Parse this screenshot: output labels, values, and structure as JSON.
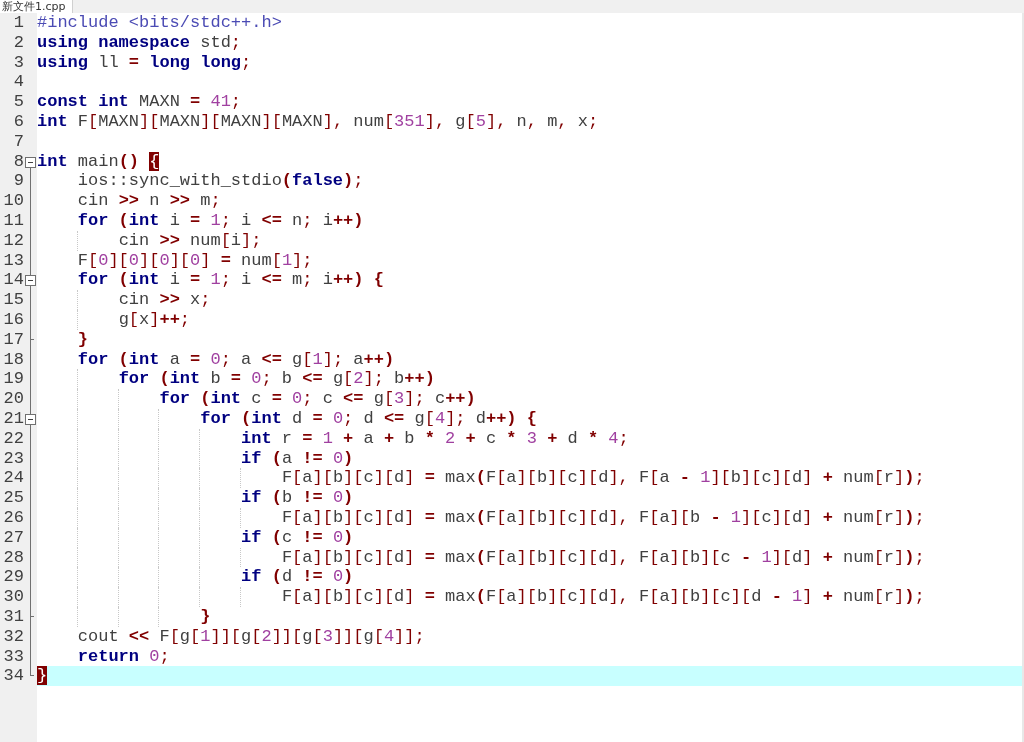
{
  "tab": {
    "title": "新文件1.cpp"
  },
  "lines": [
    {
      "number": "1",
      "kind": "plain",
      "current": false,
      "tokens": [
        {
          "kind": "pp",
          "text": "#include <bits/stdc++.h>"
        }
      ]
    },
    {
      "number": "2",
      "kind": "plain",
      "current": false,
      "tokens": [
        {
          "kind": "kw",
          "text": "using"
        },
        {
          "kind": "kw",
          "text": " namespace"
        },
        {
          "kind": "id",
          "text": " std"
        },
        {
          "kind": "sym",
          "text": ";"
        }
      ]
    },
    {
      "number": "3",
      "kind": "plain",
      "current": false,
      "tokens": [
        {
          "kind": "kw",
          "text": "using"
        },
        {
          "kind": "id",
          "text": " ll "
        },
        {
          "kind": "op",
          "text": "="
        },
        {
          "kind": "kw",
          "text": " long"
        },
        {
          "kind": "kw",
          "text": " long"
        },
        {
          "kind": "sym",
          "text": ";"
        }
      ]
    },
    {
      "number": "4",
      "kind": "plain",
      "current": false
    },
    {
      "number": "5",
      "kind": "plain",
      "current": false,
      "tokens": [
        {
          "kind": "kw",
          "text": "const"
        },
        {
          "kind": "kw",
          "text": " int"
        },
        {
          "kind": "id",
          "text": " MAXN "
        },
        {
          "kind": "op",
          "text": "="
        },
        {
          "kind": "num",
          "text": " 41"
        },
        {
          "kind": "sym",
          "text": ";"
        }
      ]
    },
    {
      "number": "6",
      "kind": "plain",
      "current": false,
      "tokens": [
        {
          "kind": "kw",
          "text": "int"
        },
        {
          "kind": "id",
          "text": " F"
        },
        {
          "kind": "sym",
          "text": "["
        },
        {
          "kind": "id",
          "text": "MAXN"
        },
        {
          "kind": "sym",
          "text": "]["
        },
        {
          "kind": "id",
          "text": "MAXN"
        },
        {
          "kind": "sym",
          "text": "]["
        },
        {
          "kind": "id",
          "text": "MAXN"
        },
        {
          "kind": "sym",
          "text": "]["
        },
        {
          "kind": "id",
          "text": "MAXN"
        },
        {
          "kind": "sym",
          "text": "],"
        },
        {
          "kind": "id",
          "text": " num"
        },
        {
          "kind": "sym",
          "text": "["
        },
        {
          "kind": "num",
          "text": "351"
        },
        {
          "kind": "sym",
          "text": "],"
        },
        {
          "kind": "id",
          "text": " g"
        },
        {
          "kind": "sym",
          "text": "["
        },
        {
          "kind": "num",
          "text": "5"
        },
        {
          "kind": "sym",
          "text": "],"
        },
        {
          "kind": "id",
          "text": " n"
        },
        {
          "kind": "sym",
          "text": ","
        },
        {
          "kind": "id",
          "text": " m"
        },
        {
          "kind": "sym",
          "text": ","
        },
        {
          "kind": "id",
          "text": " x"
        },
        {
          "kind": "sym",
          "text": ";"
        }
      ]
    },
    {
      "number": "7",
      "kind": "plain",
      "current": false
    },
    {
      "number": "8",
      "kind": "start",
      "current": false,
      "tokens": [
        {
          "kind": "kw",
          "text": "int"
        },
        {
          "kind": "id",
          "text": " main"
        },
        {
          "kind": "op",
          "text": "() "
        },
        {
          "kind": "match",
          "text": "{"
        }
      ]
    },
    {
      "number": "9",
      "kind": "plain",
      "current": false,
      "tokens": [
        {
          "kind": "id",
          "text": "    ios::sync_with_stdio"
        },
        {
          "kind": "op",
          "text": "("
        },
        {
          "kind": "kw",
          "text": "false"
        },
        {
          "kind": "op",
          "text": ")"
        },
        {
          "kind": "sym",
          "text": ";"
        }
      ]
    },
    {
      "number": "10",
      "kind": "plain",
      "current": false,
      "tokens": [
        {
          "kind": "id",
          "text": "    cin "
        },
        {
          "kind": "op",
          "text": ">>"
        },
        {
          "kind": "id",
          "text": " n "
        },
        {
          "kind": "op",
          "text": ">>"
        },
        {
          "kind": "id",
          "text": " m"
        },
        {
          "kind": "sym",
          "text": ";"
        }
      ]
    },
    {
      "number": "11",
      "kind": "plain",
      "current": false,
      "tokens": [
        {
          "kind": "kw",
          "text": "    for"
        },
        {
          "kind": "op",
          "text": " ("
        },
        {
          "kind": "kw",
          "text": "int"
        },
        {
          "kind": "id",
          "text": " i "
        },
        {
          "kind": "op",
          "text": "="
        },
        {
          "kind": "num",
          "text": " 1"
        },
        {
          "kind": "sym",
          "text": ";"
        },
        {
          "kind": "id",
          "text": " i "
        },
        {
          "kind": "op",
          "text": "<="
        },
        {
          "kind": "id",
          "text": " n"
        },
        {
          "kind": "sym",
          "text": ";"
        },
        {
          "kind": "id",
          "text": " i"
        },
        {
          "kind": "op",
          "text": "++)"
        }
      ]
    },
    {
      "number": "12",
      "kind": "plain",
      "current": false,
      "tokens": [
        {
          "kind": "id",
          "text": "        cin "
        },
        {
          "kind": "op",
          "text": ">>"
        },
        {
          "kind": "id",
          "text": " num"
        },
        {
          "kind": "sym",
          "text": "["
        },
        {
          "kind": "id",
          "text": "i"
        },
        {
          "kind": "sym",
          "text": "];"
        }
      ]
    },
    {
      "number": "13",
      "kind": "plain",
      "current": false,
      "tokens": [
        {
          "kind": "id",
          "text": "    F"
        },
        {
          "kind": "sym",
          "text": "["
        },
        {
          "kind": "num",
          "text": "0"
        },
        {
          "kind": "sym",
          "text": "]["
        },
        {
          "kind": "num",
          "text": "0"
        },
        {
          "kind": "sym",
          "text": "]["
        },
        {
          "kind": "num",
          "text": "0"
        },
        {
          "kind": "sym",
          "text": "]["
        },
        {
          "kind": "num",
          "text": "0"
        },
        {
          "kind": "sym",
          "text": "]"
        },
        {
          "kind": "op",
          "text": " ="
        },
        {
          "kind": "id",
          "text": " num"
        },
        {
          "kind": "sym",
          "text": "["
        },
        {
          "kind": "num",
          "text": "1"
        },
        {
          "kind": "sym",
          "text": "];"
        }
      ]
    },
    {
      "number": "14",
      "kind": "start",
      "current": false,
      "tokens": [
        {
          "kind": "kw",
          "text": "    for"
        },
        {
          "kind": "op",
          "text": " ("
        },
        {
          "kind": "kw",
          "text": "int"
        },
        {
          "kind": "id",
          "text": " i "
        },
        {
          "kind": "op",
          "text": "="
        },
        {
          "kind": "num",
          "text": " 1"
        },
        {
          "kind": "sym",
          "text": ";"
        },
        {
          "kind": "id",
          "text": " i "
        },
        {
          "kind": "op",
          "text": "<="
        },
        {
          "kind": "id",
          "text": " m"
        },
        {
          "kind": "sym",
          "text": ";"
        },
        {
          "kind": "id",
          "text": " i"
        },
        {
          "kind": "op",
          "text": "++)"
        },
        {
          "kind": "op",
          "text": " {"
        }
      ]
    },
    {
      "number": "15",
      "kind": "plain",
      "current": false,
      "tokens": [
        {
          "kind": "id",
          "text": "        cin "
        },
        {
          "kind": "op",
          "text": ">>"
        },
        {
          "kind": "id",
          "text": " x"
        },
        {
          "kind": "sym",
          "text": ";"
        }
      ]
    },
    {
      "number": "16",
      "kind": "plain",
      "current": false,
      "tokens": [
        {
          "kind": "id",
          "text": "        g"
        },
        {
          "kind": "sym",
          "text": "["
        },
        {
          "kind": "id",
          "text": "x"
        },
        {
          "kind": "sym",
          "text": "]"
        },
        {
          "kind": "op",
          "text": "++"
        },
        {
          "kind": "sym",
          "text": ";"
        }
      ]
    },
    {
      "number": "17",
      "kind": "end",
      "current": false,
      "tokens": [
        {
          "kind": "op",
          "text": "    }"
        }
      ]
    },
    {
      "number": "18",
      "kind": "plain",
      "current": false,
      "tokens": [
        {
          "kind": "kw",
          "text": "    for"
        },
        {
          "kind": "op",
          "text": " ("
        },
        {
          "kind": "kw",
          "text": "int"
        },
        {
          "kind": "id",
          "text": " a "
        },
        {
          "kind": "op",
          "text": "="
        },
        {
          "kind": "num",
          "text": " 0"
        },
        {
          "kind": "sym",
          "text": ";"
        },
        {
          "kind": "id",
          "text": " a "
        },
        {
          "kind": "op",
          "text": "<="
        },
        {
          "kind": "id",
          "text": " g"
        },
        {
          "kind": "sym",
          "text": "["
        },
        {
          "kind": "num",
          "text": "1"
        },
        {
          "kind": "sym",
          "text": "];"
        },
        {
          "kind": "id",
          "text": " a"
        },
        {
          "kind": "op",
          "text": "++)"
        }
      ]
    },
    {
      "number": "19",
      "kind": "plain",
      "current": false,
      "tokens": [
        {
          "kind": "kw",
          "text": "        for"
        },
        {
          "kind": "op",
          "text": " ("
        },
        {
          "kind": "kw",
          "text": "int"
        },
        {
          "kind": "id",
          "text": " b "
        },
        {
          "kind": "op",
          "text": "="
        },
        {
          "kind": "num",
          "text": " 0"
        },
        {
          "kind": "sym",
          "text": ";"
        },
        {
          "kind": "id",
          "text": " b "
        },
        {
          "kind": "op",
          "text": "<="
        },
        {
          "kind": "id",
          "text": " g"
        },
        {
          "kind": "sym",
          "text": "["
        },
        {
          "kind": "num",
          "text": "2"
        },
        {
          "kind": "sym",
          "text": "];"
        },
        {
          "kind": "id",
          "text": " b"
        },
        {
          "kind": "op",
          "text": "++)"
        }
      ]
    },
    {
      "number": "20",
      "kind": "plain",
      "current": false,
      "tokens": [
        {
          "kind": "kw",
          "text": "            for"
        },
        {
          "kind": "op",
          "text": " ("
        },
        {
          "kind": "kw",
          "text": "int"
        },
        {
          "kind": "id",
          "text": " c "
        },
        {
          "kind": "op",
          "text": "="
        },
        {
          "kind": "num",
          "text": " 0"
        },
        {
          "kind": "sym",
          "text": ";"
        },
        {
          "kind": "id",
          "text": " c "
        },
        {
          "kind": "op",
          "text": "<="
        },
        {
          "kind": "id",
          "text": " g"
        },
        {
          "kind": "sym",
          "text": "["
        },
        {
          "kind": "num",
          "text": "3"
        },
        {
          "kind": "sym",
          "text": "];"
        },
        {
          "kind": "id",
          "text": " c"
        },
        {
          "kind": "op",
          "text": "++)"
        }
      ]
    },
    {
      "number": "21",
      "kind": "start",
      "current": false,
      "tokens": [
        {
          "kind": "kw",
          "text": "                for"
        },
        {
          "kind": "op",
          "text": " ("
        },
        {
          "kind": "kw",
          "text": "int"
        },
        {
          "kind": "id",
          "text": " d "
        },
        {
          "kind": "op",
          "text": "="
        },
        {
          "kind": "num",
          "text": " 0"
        },
        {
          "kind": "sym",
          "text": ";"
        },
        {
          "kind": "id",
          "text": " d "
        },
        {
          "kind": "op",
          "text": "<="
        },
        {
          "kind": "id",
          "text": " g"
        },
        {
          "kind": "sym",
          "text": "["
        },
        {
          "kind": "num",
          "text": "4"
        },
        {
          "kind": "sym",
          "text": "];"
        },
        {
          "kind": "id",
          "text": " d"
        },
        {
          "kind": "op",
          "text": "++)"
        },
        {
          "kind": "op",
          "text": " {"
        }
      ]
    },
    {
      "number": "22",
      "kind": "plain",
      "current": false,
      "tokens": [
        {
          "kind": "kw",
          "text": "                    int"
        },
        {
          "kind": "id",
          "text": " r "
        },
        {
          "kind": "op",
          "text": "="
        },
        {
          "kind": "num",
          "text": " 1"
        },
        {
          "kind": "op",
          "text": " +"
        },
        {
          "kind": "id",
          "text": " a "
        },
        {
          "kind": "op",
          "text": "+"
        },
        {
          "kind": "id",
          "text": " b "
        },
        {
          "kind": "op",
          "text": "*"
        },
        {
          "kind": "num",
          "text": " 2"
        },
        {
          "kind": "op",
          "text": " +"
        },
        {
          "kind": "id",
          "text": " c "
        },
        {
          "kind": "op",
          "text": "*"
        },
        {
          "kind": "num",
          "text": " 3"
        },
        {
          "kind": "op",
          "text": " +"
        },
        {
          "kind": "id",
          "text": " d "
        },
        {
          "kind": "op",
          "text": "*"
        },
        {
          "kind": "num",
          "text": " 4"
        },
        {
          "kind": "sym",
          "text": ";"
        }
      ]
    },
    {
      "number": "23",
      "kind": "plain",
      "current": false,
      "tokens": [
        {
          "kind": "kw",
          "text": "                    if"
        },
        {
          "kind": "op",
          "text": " ("
        },
        {
          "kind": "id",
          "text": "a "
        },
        {
          "kind": "op",
          "text": "!="
        },
        {
          "kind": "num",
          "text": " 0"
        },
        {
          "kind": "op",
          "text": ")"
        }
      ]
    },
    {
      "number": "24",
      "kind": "plain",
      "current": false,
      "tokens": [
        {
          "kind": "id",
          "text": "                        F"
        },
        {
          "kind": "sym",
          "text": "["
        },
        {
          "kind": "id",
          "text": "a"
        },
        {
          "kind": "sym",
          "text": "]["
        },
        {
          "kind": "id",
          "text": "b"
        },
        {
          "kind": "sym",
          "text": "]["
        },
        {
          "kind": "id",
          "text": "c"
        },
        {
          "kind": "sym",
          "text": "]["
        },
        {
          "kind": "id",
          "text": "d"
        },
        {
          "kind": "sym",
          "text": "]"
        },
        {
          "kind": "op",
          "text": " ="
        },
        {
          "kind": "id",
          "text": " max"
        },
        {
          "kind": "op",
          "text": "("
        },
        {
          "kind": "id",
          "text": "F"
        },
        {
          "kind": "sym",
          "text": "["
        },
        {
          "kind": "id",
          "text": "a"
        },
        {
          "kind": "sym",
          "text": "]["
        },
        {
          "kind": "id",
          "text": "b"
        },
        {
          "kind": "sym",
          "text": "]["
        },
        {
          "kind": "id",
          "text": "c"
        },
        {
          "kind": "sym",
          "text": "]["
        },
        {
          "kind": "id",
          "text": "d"
        },
        {
          "kind": "sym",
          "text": "],"
        },
        {
          "kind": "id",
          "text": " F"
        },
        {
          "kind": "sym",
          "text": "["
        },
        {
          "kind": "id",
          "text": "a "
        },
        {
          "kind": "op",
          "text": "-"
        },
        {
          "kind": "num",
          "text": " 1"
        },
        {
          "kind": "sym",
          "text": "]["
        },
        {
          "kind": "id",
          "text": "b"
        },
        {
          "kind": "sym",
          "text": "]["
        },
        {
          "kind": "id",
          "text": "c"
        },
        {
          "kind": "sym",
          "text": "]["
        },
        {
          "kind": "id",
          "text": "d"
        },
        {
          "kind": "sym",
          "text": "]"
        },
        {
          "kind": "op",
          "text": " +"
        },
        {
          "kind": "id",
          "text": " num"
        },
        {
          "kind": "sym",
          "text": "["
        },
        {
          "kind": "id",
          "text": "r"
        },
        {
          "kind": "sym",
          "text": "]"
        },
        {
          "kind": "op",
          "text": ")"
        },
        {
          "kind": "sym",
          "text": ";"
        }
      ]
    },
    {
      "number": "25",
      "kind": "plain",
      "current": false,
      "tokens": [
        {
          "kind": "kw",
          "text": "                    if"
        },
        {
          "kind": "op",
          "text": " ("
        },
        {
          "kind": "id",
          "text": "b "
        },
        {
          "kind": "op",
          "text": "!="
        },
        {
          "kind": "num",
          "text": " 0"
        },
        {
          "kind": "op",
          "text": ")"
        }
      ]
    },
    {
      "number": "26",
      "kind": "plain",
      "current": false,
      "tokens": [
        {
          "kind": "id",
          "text": "                        F"
        },
        {
          "kind": "sym",
          "text": "["
        },
        {
          "kind": "id",
          "text": "a"
        },
        {
          "kind": "sym",
          "text": "]["
        },
        {
          "kind": "id",
          "text": "b"
        },
        {
          "kind": "sym",
          "text": "]["
        },
        {
          "kind": "id",
          "text": "c"
        },
        {
          "kind": "sym",
          "text": "]["
        },
        {
          "kind": "id",
          "text": "d"
        },
        {
          "kind": "sym",
          "text": "]"
        },
        {
          "kind": "op",
          "text": " ="
        },
        {
          "kind": "id",
          "text": " max"
        },
        {
          "kind": "op",
          "text": "("
        },
        {
          "kind": "id",
          "text": "F"
        },
        {
          "kind": "sym",
          "text": "["
        },
        {
          "kind": "id",
          "text": "a"
        },
        {
          "kind": "sym",
          "text": "]["
        },
        {
          "kind": "id",
          "text": "b"
        },
        {
          "kind": "sym",
          "text": "]["
        },
        {
          "kind": "id",
          "text": "c"
        },
        {
          "kind": "sym",
          "text": "]["
        },
        {
          "kind": "id",
          "text": "d"
        },
        {
          "kind": "sym",
          "text": "],"
        },
        {
          "kind": "id",
          "text": " F"
        },
        {
          "kind": "sym",
          "text": "["
        },
        {
          "kind": "id",
          "text": "a"
        },
        {
          "kind": "sym",
          "text": "]["
        },
        {
          "kind": "id",
          "text": "b "
        },
        {
          "kind": "op",
          "text": "-"
        },
        {
          "kind": "num",
          "text": " 1"
        },
        {
          "kind": "sym",
          "text": "]["
        },
        {
          "kind": "id",
          "text": "c"
        },
        {
          "kind": "sym",
          "text": "]["
        },
        {
          "kind": "id",
          "text": "d"
        },
        {
          "kind": "sym",
          "text": "]"
        },
        {
          "kind": "op",
          "text": " +"
        },
        {
          "kind": "id",
          "text": " num"
        },
        {
          "kind": "sym",
          "text": "["
        },
        {
          "kind": "id",
          "text": "r"
        },
        {
          "kind": "sym",
          "text": "]"
        },
        {
          "kind": "op",
          "text": ")"
        },
        {
          "kind": "sym",
          "text": ";"
        }
      ]
    },
    {
      "number": "27",
      "kind": "plain",
      "current": false,
      "tokens": [
        {
          "kind": "kw",
          "text": "                    if"
        },
        {
          "kind": "op",
          "text": " ("
        },
        {
          "kind": "id",
          "text": "c "
        },
        {
          "kind": "op",
          "text": "!="
        },
        {
          "kind": "num",
          "text": " 0"
        },
        {
          "kind": "op",
          "text": ")"
        }
      ]
    },
    {
      "number": "28",
      "kind": "plain",
      "current": false,
      "tokens": [
        {
          "kind": "id",
          "text": "                        F"
        },
        {
          "kind": "sym",
          "text": "["
        },
        {
          "kind": "id",
          "text": "a"
        },
        {
          "kind": "sym",
          "text": "]["
        },
        {
          "kind": "id",
          "text": "b"
        },
        {
          "kind": "sym",
          "text": "]["
        },
        {
          "kind": "id",
          "text": "c"
        },
        {
          "kind": "sym",
          "text": "]["
        },
        {
          "kind": "id",
          "text": "d"
        },
        {
          "kind": "sym",
          "text": "]"
        },
        {
          "kind": "op",
          "text": " ="
        },
        {
          "kind": "id",
          "text": " max"
        },
        {
          "kind": "op",
          "text": "("
        },
        {
          "kind": "id",
          "text": "F"
        },
        {
          "kind": "sym",
          "text": "["
        },
        {
          "kind": "id",
          "text": "a"
        },
        {
          "kind": "sym",
          "text": "]["
        },
        {
          "kind": "id",
          "text": "b"
        },
        {
          "kind": "sym",
          "text": "]["
        },
        {
          "kind": "id",
          "text": "c"
        },
        {
          "kind": "sym",
          "text": "]["
        },
        {
          "kind": "id",
          "text": "d"
        },
        {
          "kind": "sym",
          "text": "],"
        },
        {
          "kind": "id",
          "text": " F"
        },
        {
          "kind": "sym",
          "text": "["
        },
        {
          "kind": "id",
          "text": "a"
        },
        {
          "kind": "sym",
          "text": "]["
        },
        {
          "kind": "id",
          "text": "b"
        },
        {
          "kind": "sym",
          "text": "]["
        },
        {
          "kind": "id",
          "text": "c "
        },
        {
          "kind": "op",
          "text": "-"
        },
        {
          "kind": "num",
          "text": " 1"
        },
        {
          "kind": "sym",
          "text": "]["
        },
        {
          "kind": "id",
          "text": "d"
        },
        {
          "kind": "sym",
          "text": "]"
        },
        {
          "kind": "op",
          "text": " +"
        },
        {
          "kind": "id",
          "text": " num"
        },
        {
          "kind": "sym",
          "text": "["
        },
        {
          "kind": "id",
          "text": "r"
        },
        {
          "kind": "sym",
          "text": "]"
        },
        {
          "kind": "op",
          "text": ")"
        },
        {
          "kind": "sym",
          "text": ";"
        }
      ]
    },
    {
      "number": "29",
      "kind": "plain",
      "current": false,
      "tokens": [
        {
          "kind": "kw",
          "text": "                    if"
        },
        {
          "kind": "op",
          "text": " ("
        },
        {
          "kind": "id",
          "text": "d "
        },
        {
          "kind": "op",
          "text": "!="
        },
        {
          "kind": "num",
          "text": " 0"
        },
        {
          "kind": "op",
          "text": ")"
        }
      ]
    },
    {
      "number": "30",
      "kind": "plain",
      "current": false,
      "tokens": [
        {
          "kind": "id",
          "text": "                        F"
        },
        {
          "kind": "sym",
          "text": "["
        },
        {
          "kind": "id",
          "text": "a"
        },
        {
          "kind": "sym",
          "text": "]["
        },
        {
          "kind": "id",
          "text": "b"
        },
        {
          "kind": "sym",
          "text": "]["
        },
        {
          "kind": "id",
          "text": "c"
        },
        {
          "kind": "sym",
          "text": "]["
        },
        {
          "kind": "id",
          "text": "d"
        },
        {
          "kind": "sym",
          "text": "]"
        },
        {
          "kind": "op",
          "text": " ="
        },
        {
          "kind": "id",
          "text": " max"
        },
        {
          "kind": "op",
          "text": "("
        },
        {
          "kind": "id",
          "text": "F"
        },
        {
          "kind": "sym",
          "text": "["
        },
        {
          "kind": "id",
          "text": "a"
        },
        {
          "kind": "sym",
          "text": "]["
        },
        {
          "kind": "id",
          "text": "b"
        },
        {
          "kind": "sym",
          "text": "]["
        },
        {
          "kind": "id",
          "text": "c"
        },
        {
          "kind": "sym",
          "text": "]["
        },
        {
          "kind": "id",
          "text": "d"
        },
        {
          "kind": "sym",
          "text": "],"
        },
        {
          "kind": "id",
          "text": " F"
        },
        {
          "kind": "sym",
          "text": "["
        },
        {
          "kind": "id",
          "text": "a"
        },
        {
          "kind": "sym",
          "text": "]["
        },
        {
          "kind": "id",
          "text": "b"
        },
        {
          "kind": "sym",
          "text": "]["
        },
        {
          "kind": "id",
          "text": "c"
        },
        {
          "kind": "sym",
          "text": "]["
        },
        {
          "kind": "id",
          "text": "d "
        },
        {
          "kind": "op",
          "text": "-"
        },
        {
          "kind": "num",
          "text": " 1"
        },
        {
          "kind": "sym",
          "text": "]"
        },
        {
          "kind": "op",
          "text": " +"
        },
        {
          "kind": "id",
          "text": " num"
        },
        {
          "kind": "sym",
          "text": "["
        },
        {
          "kind": "id",
          "text": "r"
        },
        {
          "kind": "sym",
          "text": "]"
        },
        {
          "kind": "op",
          "text": ")"
        },
        {
          "kind": "sym",
          "text": ";"
        }
      ]
    },
    {
      "number": "31",
      "kind": "end",
      "current": false,
      "tokens": [
        {
          "kind": "op",
          "text": "                }"
        }
      ]
    },
    {
      "number": "32",
      "kind": "plain",
      "current": false,
      "tokens": [
        {
          "kind": "id",
          "text": "    cout "
        },
        {
          "kind": "op",
          "text": "<<"
        },
        {
          "kind": "id",
          "text": " F"
        },
        {
          "kind": "sym",
          "text": "["
        },
        {
          "kind": "id",
          "text": "g"
        },
        {
          "kind": "sym",
          "text": "["
        },
        {
          "kind": "num",
          "text": "1"
        },
        {
          "kind": "sym",
          "text": "]]["
        },
        {
          "kind": "id",
          "text": "g"
        },
        {
          "kind": "sym",
          "text": "["
        },
        {
          "kind": "num",
          "text": "2"
        },
        {
          "kind": "sym",
          "text": "]]["
        },
        {
          "kind": "id",
          "text": "g"
        },
        {
          "kind": "sym",
          "text": "["
        },
        {
          "kind": "num",
          "text": "3"
        },
        {
          "kind": "sym",
          "text": "]]["
        },
        {
          "kind": "id",
          "text": "g"
        },
        {
          "kind": "sym",
          "text": "["
        },
        {
          "kind": "num",
          "text": "4"
        },
        {
          "kind": "sym",
          "text": "]];"
        }
      ]
    },
    {
      "number": "33",
      "kind": "plain",
      "current": false,
      "tokens": [
        {
          "kind": "kw",
          "text": "    return"
        },
        {
          "kind": "num",
          "text": " 0"
        },
        {
          "kind": "sym",
          "text": ";"
        }
      ]
    },
    {
      "number": "34",
      "kind": "last",
      "current": true,
      "tokens": [
        {
          "kind": "match",
          "text": "}"
        }
      ]
    }
  ]
}
